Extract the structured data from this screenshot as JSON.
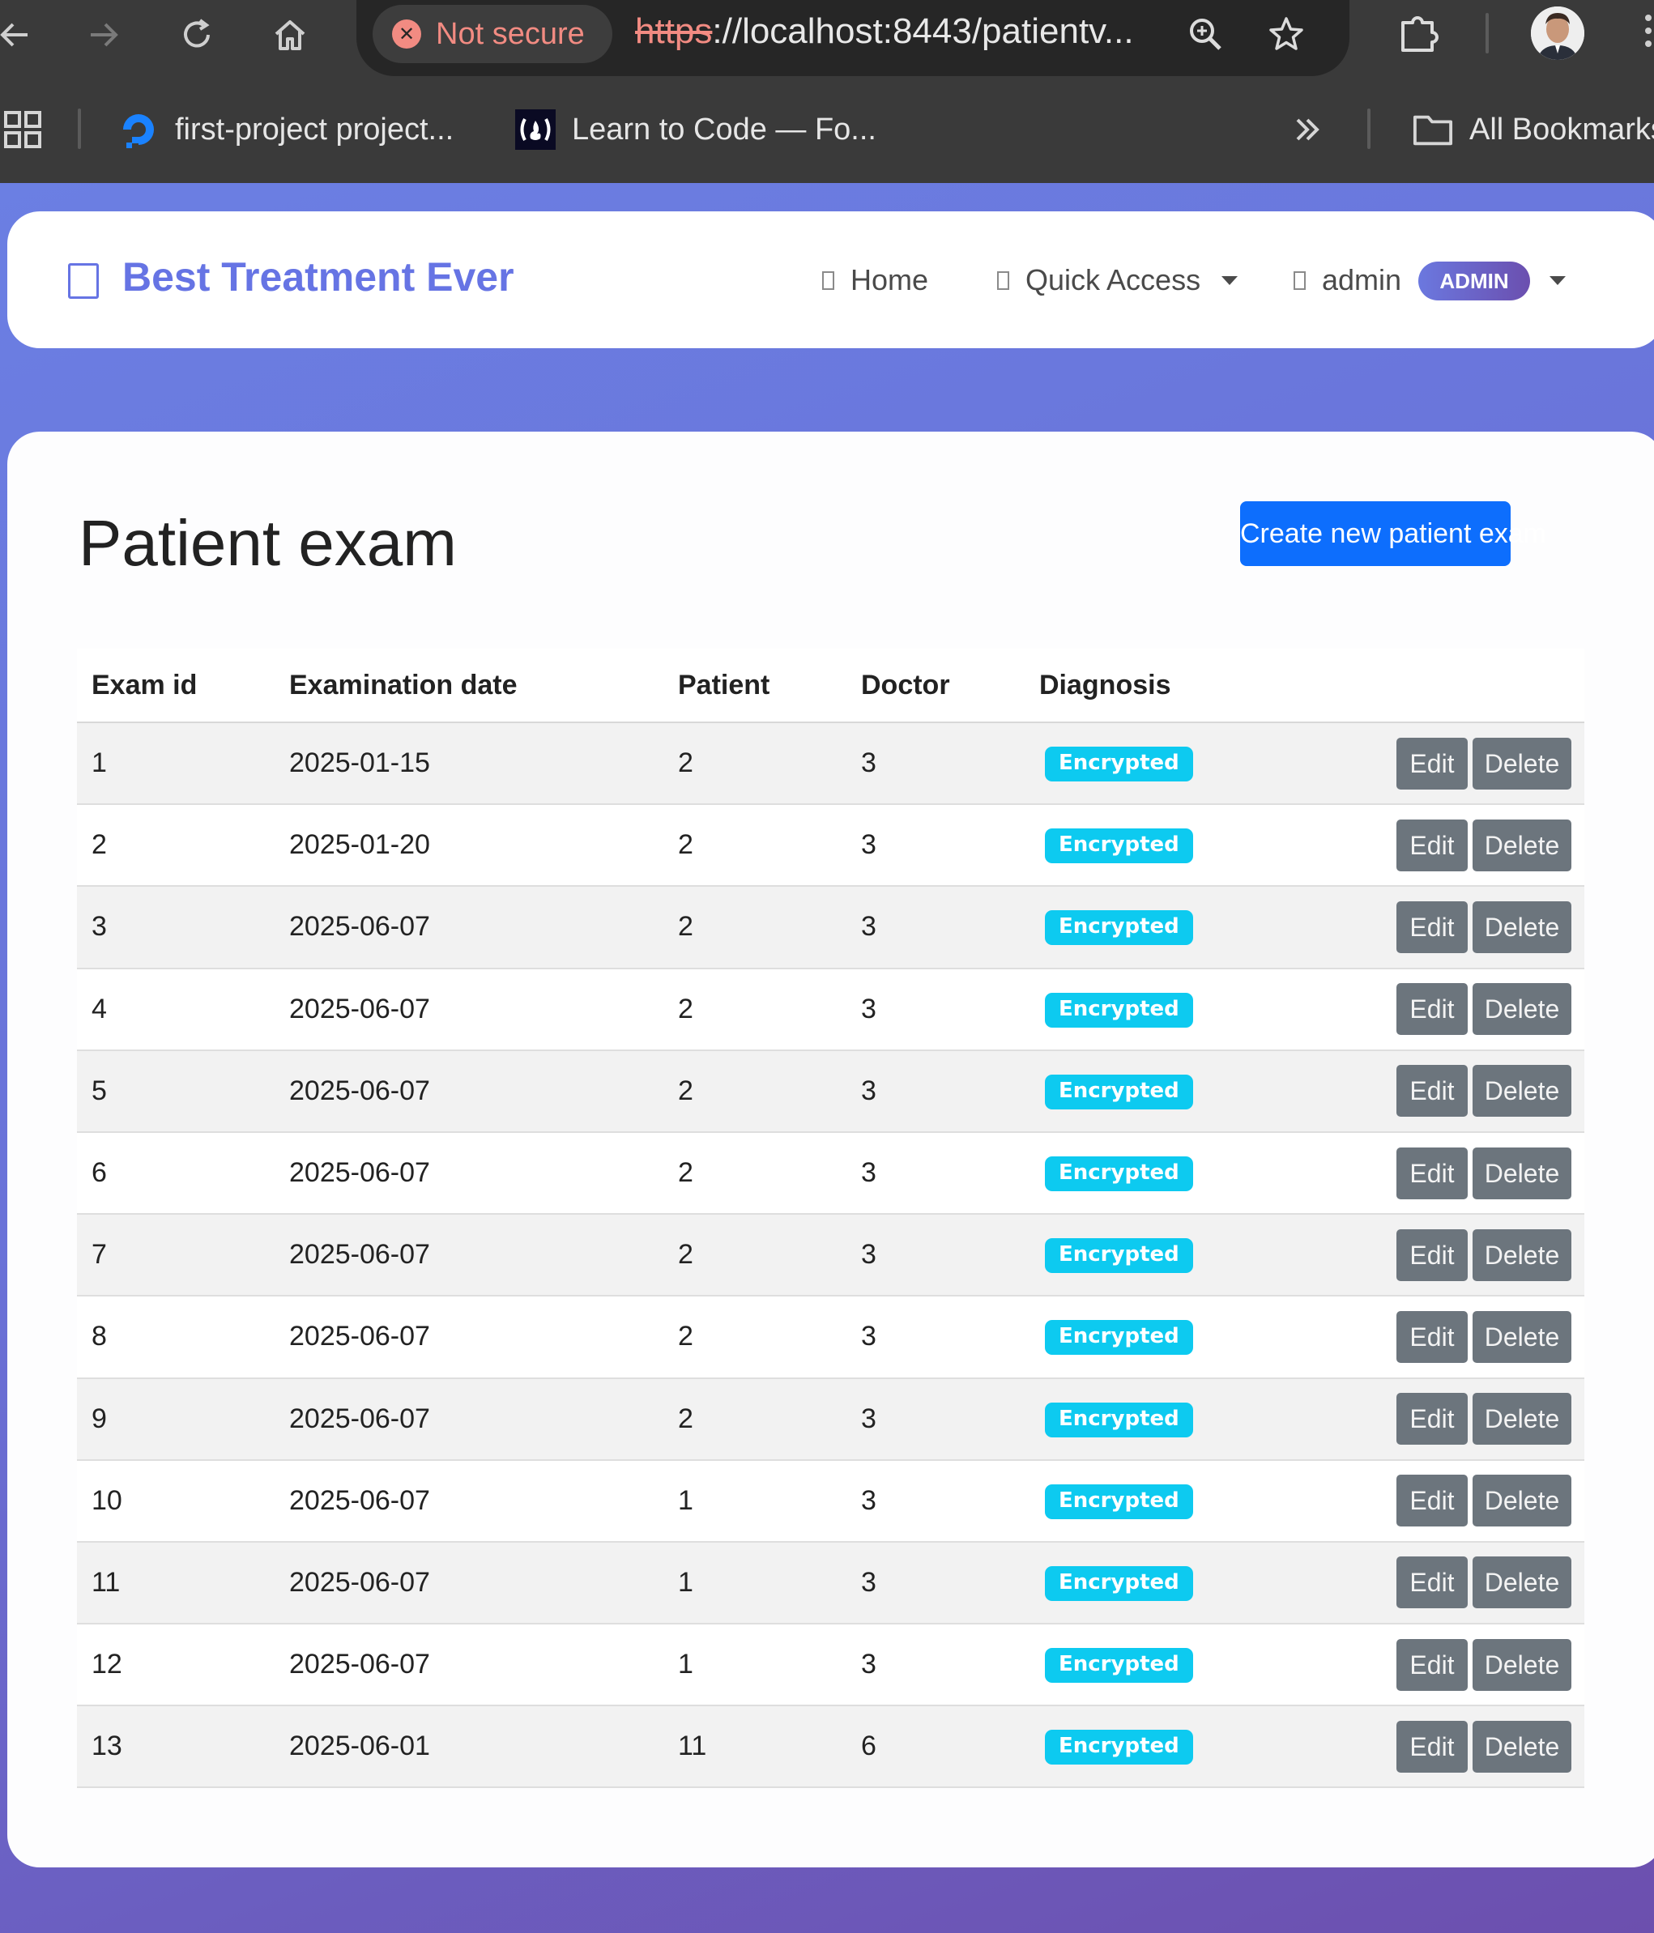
{
  "browser": {
    "secure_label": "Not secure",
    "url_scheme": "https",
    "url_rest": "://localhost:8443/patientv...",
    "bookmarks": [
      {
        "label": "first-project project...",
        "icon": "digitalocean-icon"
      },
      {
        "label": "Learn to Code — Fo...",
        "icon": "freecodecamp-icon"
      }
    ],
    "all_bookmarks_label": "All Bookmarks"
  },
  "navbar": {
    "brand": "Best Treatment Ever",
    "home_label": "Home",
    "quick_access_label": "Quick Access",
    "user_label": "admin",
    "role_badge": "ADMIN"
  },
  "page": {
    "title": "Patient exam",
    "create_button": "Create new patient exam"
  },
  "table": {
    "columns": [
      "Exam id",
      "Examination date",
      "Patient",
      "Doctor",
      "Diagnosis",
      ""
    ],
    "edit_label": "Edit",
    "delete_label": "Delete",
    "rows": [
      {
        "id": "1",
        "date": "2025-01-15",
        "patient": "2",
        "doctor": "3",
        "diagnosis": "Encrypted"
      },
      {
        "id": "2",
        "date": "2025-01-20",
        "patient": "2",
        "doctor": "3",
        "diagnosis": "Encrypted"
      },
      {
        "id": "3",
        "date": "2025-06-07",
        "patient": "2",
        "doctor": "3",
        "diagnosis": "Encrypted"
      },
      {
        "id": "4",
        "date": "2025-06-07",
        "patient": "2",
        "doctor": "3",
        "diagnosis": "Encrypted"
      },
      {
        "id": "5",
        "date": "2025-06-07",
        "patient": "2",
        "doctor": "3",
        "diagnosis": "Encrypted"
      },
      {
        "id": "6",
        "date": "2025-06-07",
        "patient": "2",
        "doctor": "3",
        "diagnosis": "Encrypted"
      },
      {
        "id": "7",
        "date": "2025-06-07",
        "patient": "2",
        "doctor": "3",
        "diagnosis": "Encrypted"
      },
      {
        "id": "8",
        "date": "2025-06-07",
        "patient": "2",
        "doctor": "3",
        "diagnosis": "Encrypted"
      },
      {
        "id": "9",
        "date": "2025-06-07",
        "patient": "2",
        "doctor": "3",
        "diagnosis": "Encrypted"
      },
      {
        "id": "10",
        "date": "2025-06-07",
        "patient": "1",
        "doctor": "3",
        "diagnosis": "Encrypted"
      },
      {
        "id": "11",
        "date": "2025-06-07",
        "patient": "1",
        "doctor": "3",
        "diagnosis": "Encrypted"
      },
      {
        "id": "12",
        "date": "2025-06-07",
        "patient": "1",
        "doctor": "3",
        "diagnosis": "Encrypted"
      },
      {
        "id": "13",
        "date": "2025-06-01",
        "patient": "11",
        "doctor": "6",
        "diagnosis": "Encrypted"
      }
    ]
  },
  "colors": {
    "brand": "#6674e4",
    "primary_button": "#0d6efd",
    "badge_info": "#0dcaf0",
    "button_secondary": "#6c757d",
    "gradient_start": "#6b7fe3",
    "gradient_end": "#6c4fae"
  }
}
